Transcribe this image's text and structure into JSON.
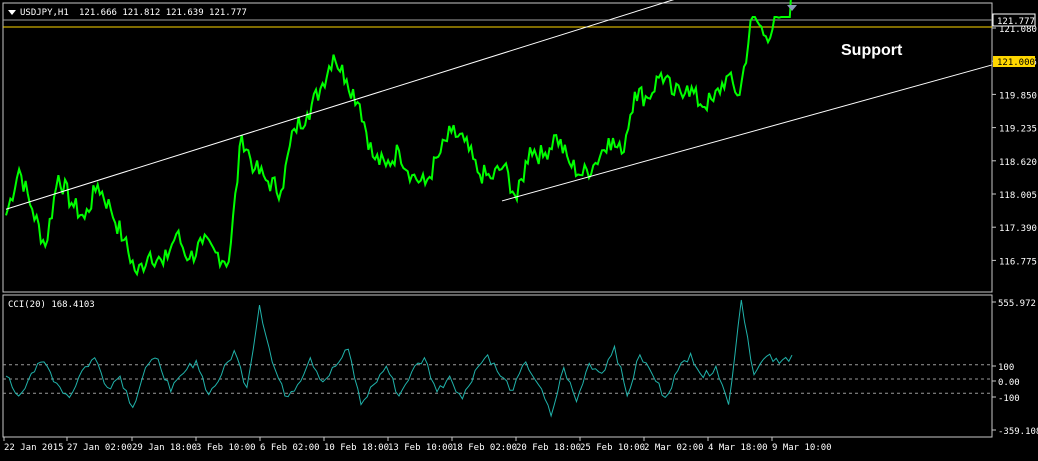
{
  "colors": {
    "background": "#000000",
    "frame": "#c8c8c8",
    "candle": "#00ff00",
    "indicator": "#20b2aa",
    "support": "#ffd700",
    "channel": "#ffffff",
    "level": "#a0a0a0",
    "marker": "#8a9bb4"
  },
  "header": {
    "menu_icon": "triangle-down-icon",
    "symbol": "USDJPY,H1",
    "ohlc": "121.666 121.812 121.639 121.777"
  },
  "annotation": {
    "text": "Support"
  },
  "price_axis": {
    "ticks": [
      "121.080",
      "120.465",
      "119.850",
      "119.235",
      "118.620",
      "118.005",
      "117.390",
      "116.775"
    ],
    "current_price": "121.777",
    "support_label": "121.000"
  },
  "indicator": {
    "title": "CCI(20) 168.4103",
    "ticks": [
      "555.972",
      "100",
      "0.00",
      "-100",
      "-359.1081"
    ]
  },
  "time_axis": {
    "labels": [
      "22 Jan 2015",
      "27 Jan 02:00",
      "29 Jan 18:00",
      "3 Feb 10:00",
      "6 Feb 02:00",
      "10 Feb 18:00",
      "13 Feb 10:00",
      "18 Feb 02:00",
      "20 Feb 18:00",
      "25 Feb 10:00",
      "2 Mar 02:00",
      "4 Mar 18:00",
      "9 Mar 10:00"
    ]
  },
  "chart_data": {
    "type": "line",
    "symbol": "USDJPY",
    "timeframe": "H1",
    "ylim": [
      116.775,
      122.05
    ],
    "price_series": {
      "values": [
        117.95,
        118.7,
        118.05,
        117.45,
        118.6,
        118.15,
        117.9,
        118.45,
        118.05,
        117.55,
        117.0,
        117.35,
        117.15,
        117.65,
        117.25,
        117.5,
        117.35,
        117.2,
        119.25,
        118.7,
        118.5,
        118.35,
        119.35,
        119.6,
        120.0,
        120.55,
        120.15,
        119.75,
        118.9,
        118.75,
        119.0,
        118.6,
        118.45,
        118.9,
        119.3,
        119.15,
        118.65,
        118.55,
        118.75,
        118.2,
        119.05,
        118.9,
        119.25,
        118.8,
        118.6,
        118.8,
        119.2,
        118.95,
        119.95,
        119.85,
        120.25,
        119.9,
        120.05,
        119.75,
        119.8,
        120.2,
        119.9,
        121.2,
        120.85,
        121.15,
        121.78
      ],
      "note": ""
    },
    "support_level": 121.0,
    "channel_upper": {
      "x": [
        "22 Jan 2015",
        "9 Mar 10:00"
      ],
      "y": [
        118.05,
        122.05
      ]
    },
    "channel_lower": {
      "x": [
        "20 Feb 18:00",
        "9 Mar 10:00"
      ],
      "y": [
        118.2,
        120.45
      ]
    },
    "cci": {
      "period": 20,
      "last": 168.4103,
      "ylim": [
        -359.1081,
        555.972
      ],
      "levels": [
        100,
        0,
        -100
      ],
      "values": [
        20,
        -120,
        40,
        120,
        -30,
        -130,
        60,
        150,
        -60,
        20,
        -200,
        80,
        140,
        -90,
        40,
        130,
        -110,
        30,
        200,
        -60,
        520,
        120,
        -120,
        -40,
        150,
        -20,
        90,
        210,
        -180,
        -40,
        90,
        -120,
        50,
        150,
        -90,
        20,
        -140,
        60,
        170,
        20,
        -80,
        120,
        -40,
        -260,
        80,
        -160,
        110,
        40,
        230,
        -120,
        170,
        30,
        -130,
        60,
        180,
        10,
        90,
        -180,
        560,
        30,
        160,
        110,
        168.41
      ]
    }
  }
}
